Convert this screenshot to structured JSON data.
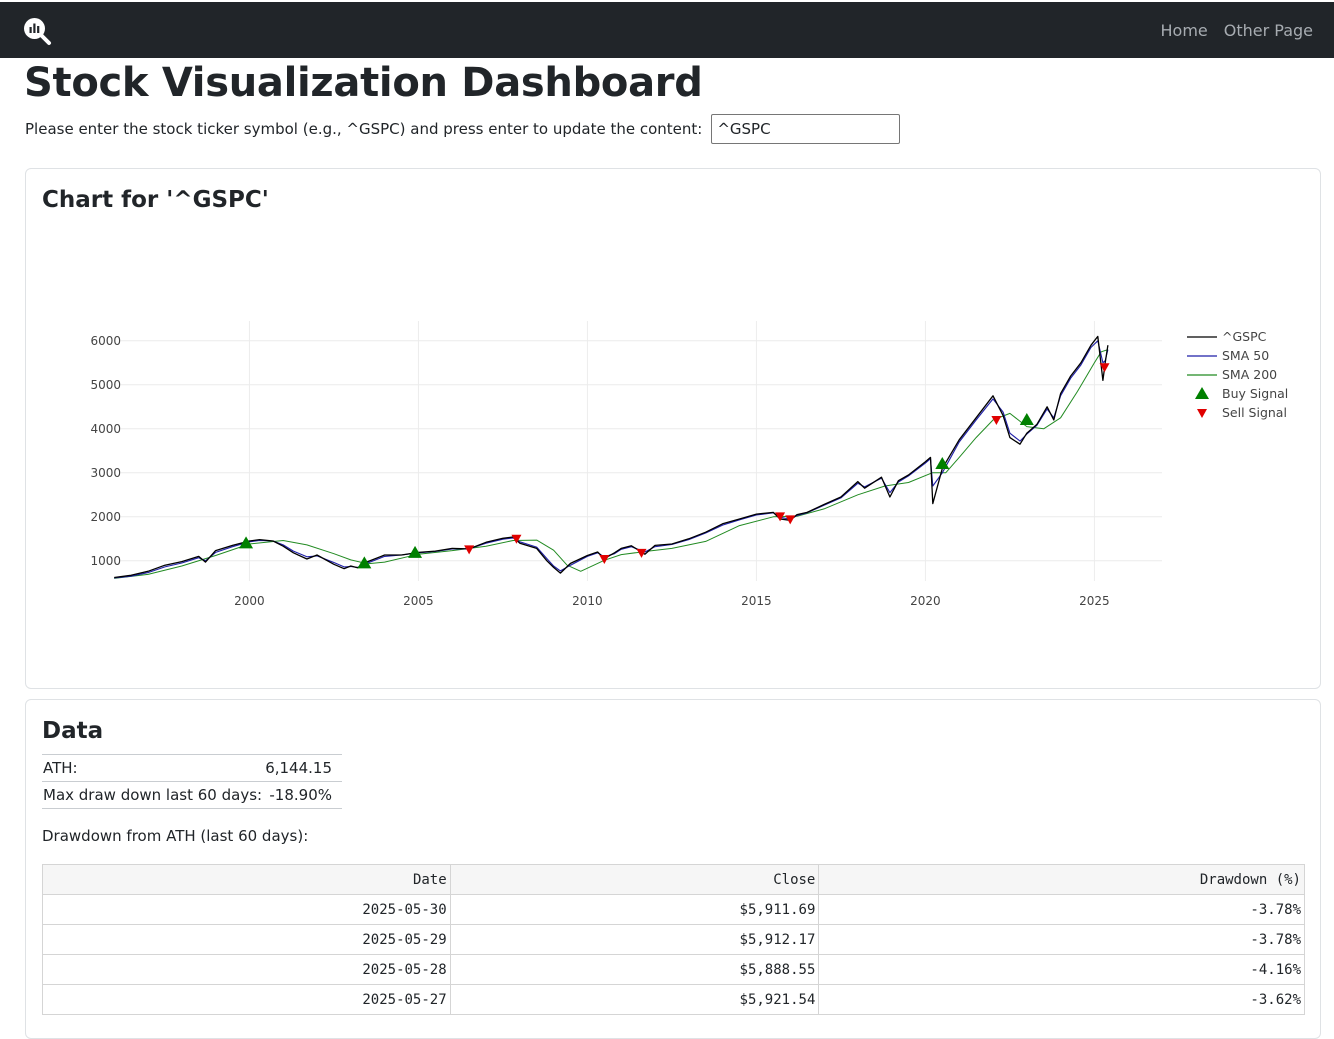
{
  "nav": {
    "logo_icon": "chart-magnifier-icon",
    "links": [
      {
        "label": "Home"
      },
      {
        "label": "Other Page"
      }
    ]
  },
  "page": {
    "title": "Stock Visualization Dashboard",
    "prompt": "Please enter the stock ticker symbol (e.g., ^GSPC) and press enter to update the content:",
    "ticker_value": "^GSPC"
  },
  "chart_card": {
    "title": "Chart for '^GSPC'"
  },
  "chart_data": {
    "type": "line",
    "x_ticks": [
      "2000",
      "2005",
      "2010",
      "2015",
      "2020",
      "2025"
    ],
    "y_ticks": [
      "1000",
      "2000",
      "3000",
      "4000",
      "5000",
      "6000"
    ],
    "xlim": [
      1996.2,
      2027
    ],
    "ylim": [
      540,
      6450
    ],
    "grid": true,
    "legend_position": "right",
    "colors": {
      "price": "#000000",
      "sma50": "#1f1fa8",
      "sma200": "#228b22",
      "buy": "#008000",
      "sell": "#e00000"
    },
    "series": [
      {
        "name": "^GSPC",
        "x": [
          1996.0,
          1996.5,
          1997.0,
          1997.5,
          1998.0,
          1998.5,
          1998.7,
          1999.0,
          1999.5,
          2000.0,
          2000.3,
          2000.7,
          2001.0,
          2001.3,
          2001.7,
          2002.0,
          2002.5,
          2002.8,
          2003.0,
          2003.2,
          2003.5,
          2004.0,
          2004.5,
          2005.0,
          2005.5,
          2006.0,
          2006.5,
          2007.0,
          2007.5,
          2007.8,
          2008.0,
          2008.5,
          2008.8,
          2009.0,
          2009.2,
          2009.5,
          2010.0,
          2010.3,
          2010.5,
          2010.8,
          2011.0,
          2011.3,
          2011.7,
          2012.0,
          2012.5,
          2013.0,
          2013.5,
          2014.0,
          2014.5,
          2015.0,
          2015.5,
          2015.7,
          2016.0,
          2016.2,
          2016.5,
          2017.0,
          2017.5,
          2018.0,
          2018.2,
          2018.7,
          2018.95,
          2019.2,
          2019.5,
          2020.0,
          2020.15,
          2020.22,
          2020.5,
          2021.0,
          2021.5,
          2022.0,
          2022.3,
          2022.5,
          2022.8,
          2023.0,
          2023.3,
          2023.6,
          2023.8,
          2024.0,
          2024.3,
          2024.6,
          2024.9,
          2025.1,
          2025.25,
          2025.32,
          2025.4
        ],
        "values": [
          620,
          670,
          760,
          900,
          980,
          1100,
          970,
          1230,
          1350,
          1450,
          1480,
          1450,
          1330,
          1180,
          1040,
          1130,
          920,
          820,
          880,
          840,
          980,
          1130,
          1130,
          1190,
          1220,
          1280,
          1270,
          1420,
          1510,
          1540,
          1400,
          1280,
          1000,
          850,
          720,
          940,
          1120,
          1200,
          1050,
          1180,
          1280,
          1340,
          1150,
          1350,
          1380,
          1500,
          1650,
          1840,
          1950,
          2060,
          2100,
          1950,
          1920,
          2050,
          2100,
          2280,
          2450,
          2800,
          2650,
          2900,
          2450,
          2820,
          2950,
          3250,
          3350,
          2300,
          3100,
          3750,
          4250,
          4750,
          4300,
          3800,
          3650,
          3900,
          4100,
          4500,
          4200,
          4800,
          5200,
          5500,
          5900,
          6100,
          5100,
          5500,
          5900
        ]
      },
      {
        "name": "SMA 50",
        "x": [
          1996.0,
          1996.5,
          1997.0,
          1997.5,
          1998.0,
          1998.5,
          1998.7,
          1999.0,
          1999.5,
          2000.0,
          2000.3,
          2000.7,
          2001.0,
          2001.3,
          2001.7,
          2002.0,
          2002.5,
          2002.8,
          2003.0,
          2003.2,
          2003.5,
          2004.0,
          2004.5,
          2005.0,
          2005.5,
          2006.0,
          2006.5,
          2007.0,
          2007.5,
          2007.8,
          2008.0,
          2008.5,
          2008.8,
          2009.0,
          2009.2,
          2009.5,
          2010.0,
          2010.3,
          2010.5,
          2010.8,
          2011.0,
          2011.3,
          2011.7,
          2012.0,
          2012.5,
          2013.0,
          2013.5,
          2014.0,
          2014.5,
          2015.0,
          2015.5,
          2015.7,
          2016.0,
          2016.2,
          2016.5,
          2017.0,
          2017.5,
          2018.0,
          2018.2,
          2018.7,
          2018.95,
          2019.2,
          2019.5,
          2020.0,
          2020.15,
          2020.22,
          2020.5,
          2021.0,
          2021.5,
          2022.0,
          2022.3,
          2022.5,
          2022.8,
          2023.0,
          2023.3,
          2023.6,
          2023.8,
          2024.0,
          2024.3,
          2024.6,
          2024.9,
          2025.1,
          2025.25,
          2025.32,
          2025.4
        ],
        "values": [
          610,
          650,
          730,
          860,
          950,
          1070,
          1000,
          1190,
          1320,
          1430,
          1460,
          1450,
          1360,
          1220,
          1090,
          1110,
          960,
          860,
          870,
          850,
          950,
          1100,
          1130,
          1180,
          1210,
          1270,
          1270,
          1400,
          1490,
          1520,
          1430,
          1310,
          1050,
          880,
          770,
          900,
          1100,
          1180,
          1090,
          1160,
          1260,
          1320,
          1200,
          1320,
          1370,
          1480,
          1630,
          1810,
          1930,
          2040,
          2090,
          1990,
          1940,
          2030,
          2090,
          2260,
          2430,
          2760,
          2680,
          2880,
          2550,
          2790,
          2930,
          3220,
          3320,
          2700,
          3000,
          3700,
          4200,
          4680,
          4380,
          3900,
          3720,
          3880,
          4080,
          4450,
          4250,
          4750,
          5150,
          5450,
          5850,
          6000,
          5500,
          5550,
          5800
        ]
      },
      {
        "name": "SMA 200",
        "x": [
          1996.0,
          1997.0,
          1998.0,
          1999.0,
          2000.0,
          2001.0,
          2001.7,
          2002.5,
          2003.0,
          2003.5,
          2004.0,
          2005.0,
          2006.0,
          2007.0,
          2007.8,
          2008.5,
          2009.0,
          2009.4,
          2009.8,
          2010.5,
          2011.0,
          2011.8,
          2012.5,
          2013.5,
          2014.5,
          2015.5,
          2016.2,
          2017.0,
          2018.0,
          2018.8,
          2019.5,
          2020.2,
          2020.6,
          2021.0,
          2021.5,
          2022.0,
          2022.5,
          2023.0,
          2023.5,
          2024.0,
          2024.5,
          2025.0,
          2025.2,
          2025.4
        ],
        "values": [
          600,
          690,
          880,
          1120,
          1380,
          1460,
          1360,
          1160,
          1020,
          930,
          970,
          1150,
          1230,
          1330,
          1460,
          1470,
          1240,
          900,
          760,
          1010,
          1140,
          1220,
          1280,
          1440,
          1800,
          2000,
          2010,
          2180,
          2500,
          2700,
          2780,
          3000,
          3000,
          3350,
          3800,
          4200,
          4350,
          4050,
          4000,
          4250,
          4850,
          5500,
          5750,
          5800
        ]
      },
      {
        "name": "Buy Signal",
        "x": [
          1999.9,
          2003.4,
          2004.9,
          2020.5,
          2023.0
        ],
        "values": [
          1395,
          940,
          1180,
          3200,
          4200
        ]
      },
      {
        "name": "Sell Signal",
        "x": [
          2006.5,
          2007.9,
          2010.5,
          2011.6,
          2015.7,
          2016.0,
          2022.1,
          2025.3
        ],
        "values": [
          1260,
          1500,
          1040,
          1180,
          2010,
          1940,
          4200,
          5400
        ]
      }
    ]
  },
  "data_card": {
    "title": "Data",
    "summary": [
      {
        "label": "ATH:",
        "value": "6,144.15"
      },
      {
        "label": "Max draw down last 60 days:",
        "value": "-18.90%"
      }
    ],
    "caption": "Drawdown from ATH (last 60 days):",
    "columns": [
      "Date",
      "Close",
      "Drawdown (%)"
    ],
    "rows": [
      [
        "2025-05-30",
        "$5,911.69",
        "-3.78%"
      ],
      [
        "2025-05-29",
        "$5,912.17",
        "-3.78%"
      ],
      [
        "2025-05-28",
        "$5,888.55",
        "-4.16%"
      ],
      [
        "2025-05-27",
        "$5,921.54",
        "-3.62%"
      ]
    ]
  }
}
